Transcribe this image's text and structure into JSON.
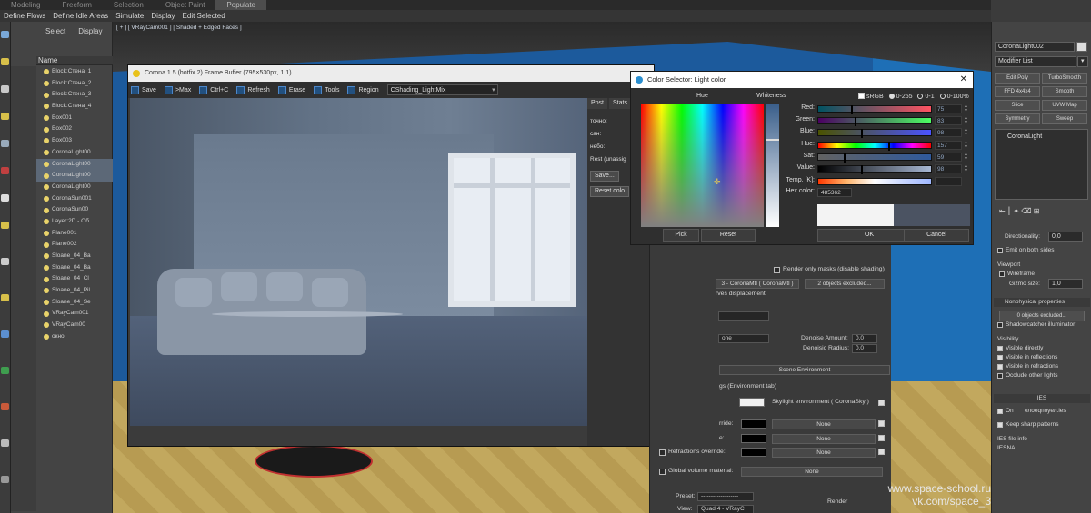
{
  "ribbon": {
    "tabs": [
      "Modeling",
      "Freeform",
      "Selection",
      "Object Paint",
      "Populate"
    ],
    "active_tab": "Populate",
    "row": [
      "Define Flows",
      "Define Idle Areas",
      "Simulate",
      "Display",
      "Edit Selected"
    ]
  },
  "explorer": {
    "select_label": "Select",
    "display_label": "Display",
    "name_header": "Name",
    "items": [
      "Block:Стена_1",
      "Block:Стена_2",
      "Block:Стена_3",
      "Block:Стена_4",
      "Box001",
      "Box002",
      "Box003",
      "CoronaLight00",
      "CoronaLight00",
      "CoronaLight00",
      "CoronaLight00",
      "CoronaSun001",
      "CoronaSun00",
      "Layer:2D - Об.",
      "Plane001",
      "Plane002",
      "Sloane_04_Ba",
      "Sloane_04_Ba",
      "Sloane_04_Cl",
      "Sloane_04_Pil",
      "Sloane_04_Se",
      "VRayCam001",
      "VRayCam00",
      "окно"
    ]
  },
  "viewport": {
    "label": "[ + ] [ VRayCam001 ] [ Shaded + Edged Faces ]"
  },
  "frame_buffer": {
    "title": "Corona 1.5 (hotfix 2) Frame Buffer (795×530px, 1:1)",
    "toolbar": {
      "save": "Save",
      "max": ">Max",
      "ctrlc": "Ctrl+C",
      "refresh": "Refresh",
      "erase": "Erase",
      "tools": "Tools",
      "region": "Region",
      "channel": "CShading_LightMix"
    },
    "right": {
      "tab_post": "Post",
      "tab_stats": "Stats",
      "line1": "точно:",
      "line2": "сан:",
      "line3": "небо:",
      "line4": "Rest (unassig",
      "save_btn": "Save...",
      "reset_btn": "Reset colo"
    }
  },
  "color_selector": {
    "title": "Color Selector: Light color",
    "hue_label": "Hue",
    "whiteness_label": "Whiteness",
    "srgb_label": "sRGB",
    "range_0_255": "0-255",
    "range_0_1": "0-1",
    "range_0_100": "0-100%",
    "red_label": "Red:",
    "red_value": "75",
    "green_label": "Green:",
    "green_value": "83",
    "blue_label": "Blue:",
    "blue_value": "98",
    "hue2_label": "Hue:",
    "hue2_value": "157",
    "sat_label": "Sat:",
    "sat_value": "59",
    "value_label": "Value:",
    "value_value": "98",
    "temp_label": "Temp. [K]:",
    "hex_label": "Hex color:",
    "hex_value": "485362",
    "pick_btn": "Pick",
    "reset_btn": "Reset",
    "ok_btn": "OK",
    "cancel_btn": "Cancel",
    "colors": {
      "preview": "#4b5362"
    }
  },
  "render_setup": {
    "render_only_masks": "Render only masks (disable shading)",
    "mtl": "3 - CoronaMtl ( CoronaMtl )",
    "objects_excluded": "2 objects excluded...",
    "displacement": "rves displacement",
    "none1": "one",
    "denoise_amount": "Denoise Amount:",
    "denoise_amount_val": "0.0",
    "denoise_radius": "Denoisic Radius:",
    "denoise_radius_val": "0.0",
    "scene_env": "Scene Environment",
    "env_tab": "gs (Environment tab)",
    "skylight": "Skylight environment ( CoronaSky )",
    "override_r": "rride:",
    "override_e": "e:",
    "refr_override": "Refractions override:",
    "global_volume": "Global volume material:",
    "none_label": "None",
    "preset_label": "Preset:",
    "preset_val": "-------------------",
    "view_label": "View:",
    "view_val": "Quad 4 - VRayC",
    "render_label": "Render"
  },
  "command_panel": {
    "object_name": "CoronaLight002",
    "modifier_list": "Modifier List",
    "mods": [
      "Edit Poly",
      "TurboSmooth",
      "FFD 4x4x4",
      "Smooth",
      "Slice",
      "UVW Map",
      "Symmetry",
      "Sweep"
    ],
    "stack_item": "CoronaLight",
    "directionality_label": "Directionality:",
    "directionality_val": "0,0",
    "emit_both": "Emit on both sides",
    "viewport_label": "Viewport",
    "wireframe": "Wireframe",
    "gizmo_label": "Gizmo size:",
    "gizmo_val": "1,0",
    "nonphys": "Nonphysical properties",
    "objects_excl": "0 objects excluded...",
    "shadowcatcher": "Shadowcatcher illuminator",
    "visibility": "Visibility",
    "visible_directly": "Visible directly",
    "visible_reflections": "Visible in reflections",
    "visible_refractions": "Visible in refractions",
    "occlude": "Occlude other lights",
    "ies": "IES",
    "on_label": "On",
    "ies_file": "елоеqпоуел.ies",
    "keep_sharp": "Keep sharp patterns",
    "ies_info": "IES file info",
    "iesna": "IESNA:"
  },
  "watermark": {
    "line1": "www.space-school.ru",
    "line2": "vk.com/space_3"
  }
}
